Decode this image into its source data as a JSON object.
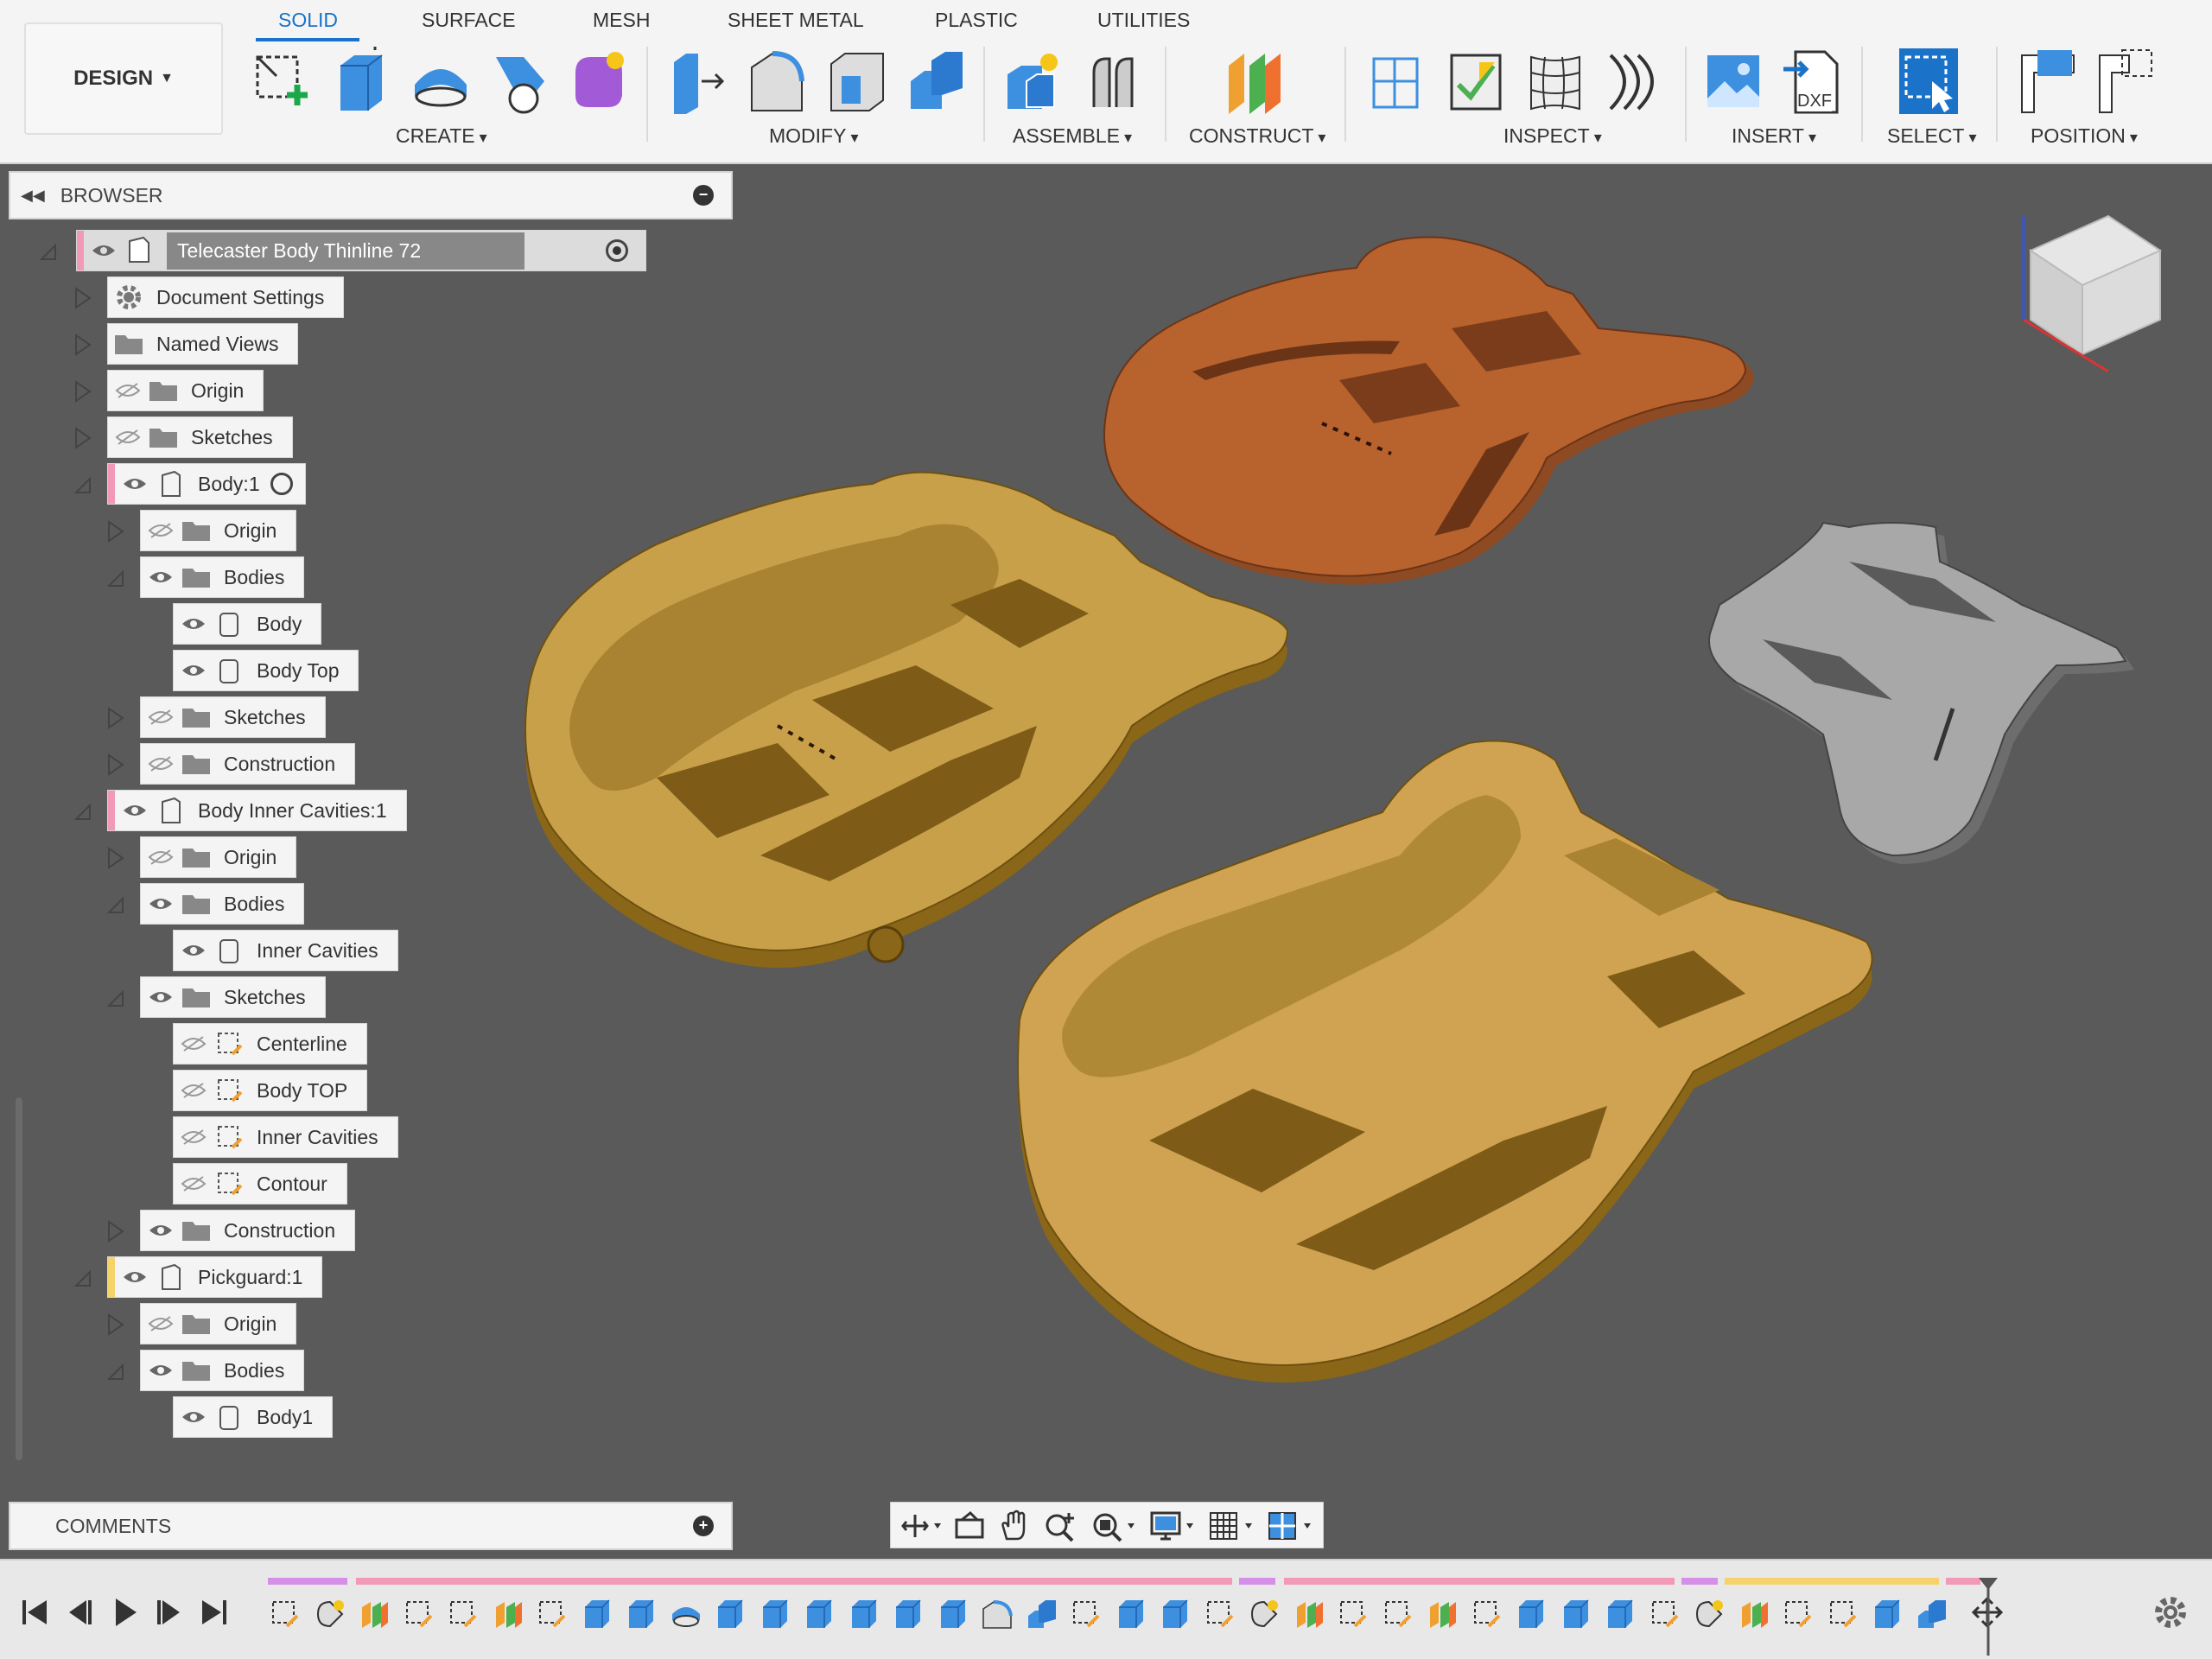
{
  "workspace": {
    "label": "DESIGN"
  },
  "tabs": [
    {
      "label": "SOLID",
      "active": true
    },
    {
      "label": "SURFACE",
      "active": false
    },
    {
      "label": "MESH",
      "active": false
    },
    {
      "label": "SHEET METAL",
      "active": false
    },
    {
      "label": "PLASTIC",
      "active": false
    },
    {
      "label": "UTILITIES",
      "active": false
    }
  ],
  "groups": {
    "create": "CREATE",
    "modify": "MODIFY",
    "assemble": "ASSEMBLE",
    "construct": "CONSTRUCT",
    "inspect": "INSPECT",
    "insert": "INSERT",
    "select": "SELECT",
    "position": "POSITION"
  },
  "insert_dxf": "DXF",
  "colors": {
    "accent": "#1a73c8",
    "viewport": "#5a5a5a",
    "body_brown": "#b8622e",
    "body_gold": "#c9a04a",
    "pickguard": "#9a9a9a"
  },
  "browser": {
    "title": "BROWSER",
    "root": "Telecaster Body Thinline 72",
    "items": {
      "document_settings": "Document Settings",
      "named_views": "Named Views",
      "origin": "Origin",
      "sketches": "Sketches",
      "body1": "Body:1",
      "body1_origin": "Origin",
      "body1_bodies": "Bodies",
      "body": "Body",
      "body_top": "Body Top",
      "body1_sketches": "Sketches",
      "body1_construction": "Construction",
      "inner_cavities1": "Body Inner Cavities:1",
      "ic_origin": "Origin",
      "ic_bodies": "Bodies",
      "inner_cavities": "Inner Cavities",
      "ic_sketches": "Sketches",
      "centerline": "Centerline",
      "body_top_sketch": "Body TOP",
      "inner_cavities_sketch": "Inner Cavities",
      "contour": "Contour",
      "ic_construction": "Construction",
      "pickguard1": "Pickguard:1",
      "pg_origin": "Origin",
      "pg_bodies": "Bodies",
      "pg_body1": "Body1"
    }
  },
  "comments": {
    "title": "COMMENTS"
  }
}
